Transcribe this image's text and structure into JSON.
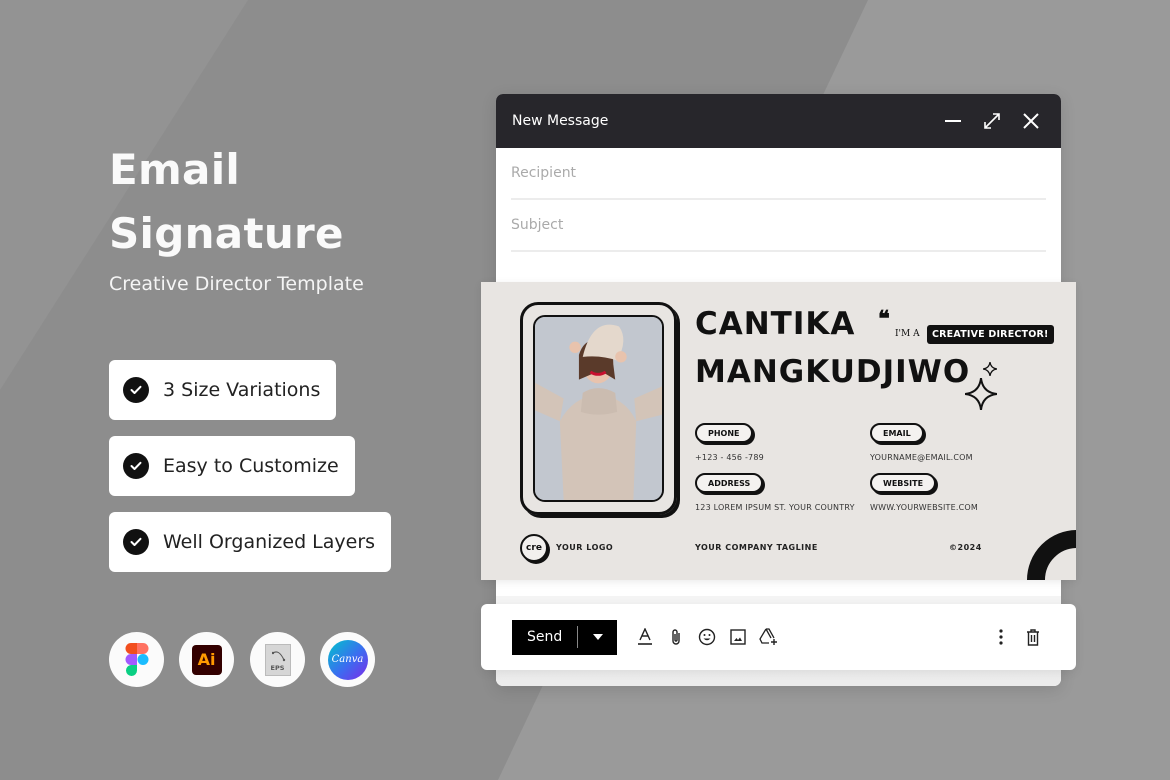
{
  "hero": {
    "title_line1": "Email",
    "title_line2": "Signature",
    "subtitle": "Creative Director Template"
  },
  "features": [
    {
      "label": "3 Size Variations",
      "icon": "check-circle-icon"
    },
    {
      "label": "Easy to Customize",
      "icon": "check-circle-icon"
    },
    {
      "label": "Well Organized Layers",
      "icon": "check-circle-icon"
    }
  ],
  "tools": [
    {
      "name": "Figma",
      "icon": "figma-icon"
    },
    {
      "name": "Ai",
      "icon": "adobe-illustrator-icon"
    },
    {
      "name": "EPS",
      "icon": "eps-file-icon"
    },
    {
      "name": "Canva",
      "icon": "canva-icon"
    }
  ],
  "window": {
    "title": "New Message",
    "controls": [
      "minimize-icon",
      "expand-icon",
      "close-icon"
    ],
    "recipient_placeholder": "Recipient",
    "subject_placeholder": "Subject"
  },
  "signature": {
    "first_name": "CANTIKA",
    "last_name": "MANGKUDJIWO",
    "quote_mark": "❝",
    "im_a": "I'M A",
    "role": "CREATIVE DIRECTOR!",
    "phone_label": "PHONE",
    "phone": "+123 - 456 -789",
    "email_label": "EMAIL",
    "email": "YOURNAME@EMAIL.COM",
    "address_label": "ADDRESS",
    "address": "123 LOREM IPSUM ST. YOUR COUNTRY",
    "website_label": "WEBSITE",
    "website": "WWW.YOURWEBSITE.COM",
    "logo_mark": "cre",
    "logo_text": "YOUR LOGO",
    "tagline": "YOUR COMPANY TAGLINE",
    "copyright": "©2024"
  },
  "compose": {
    "send_label": "Send",
    "tools": [
      "text-format-icon",
      "attach-icon",
      "emoji-icon",
      "image-icon",
      "drive-icon"
    ],
    "right_tools": [
      "more-options-icon",
      "trash-icon"
    ]
  },
  "colors": {
    "background": "#8d8d8d",
    "titlebar": "#27262b",
    "signature_bg": "#e8e5e2",
    "accent": "#111111"
  }
}
